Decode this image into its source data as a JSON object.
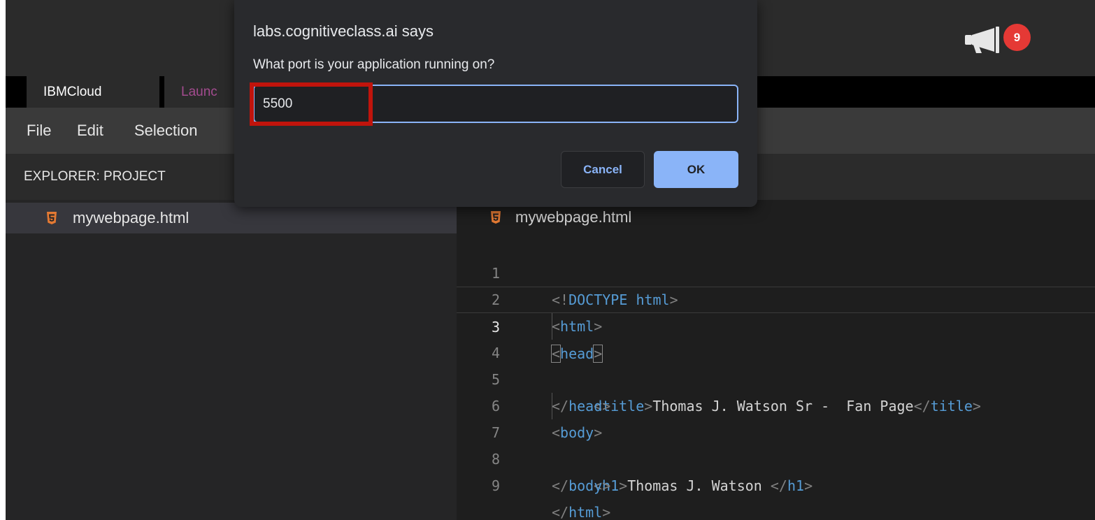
{
  "notifications": {
    "count": "9"
  },
  "tabs": [
    {
      "label": "IBMCloud"
    },
    {
      "label": "Launc"
    }
  ],
  "menu": [
    "File",
    "Edit",
    "Selection"
  ],
  "explorer": {
    "header": "EXPLORER: PROJECT",
    "files": [
      {
        "name": "mywebpage.html",
        "icon": "html5-icon"
      }
    ]
  },
  "editor": {
    "tab_title": "mywebpage.html",
    "current_line": 3,
    "lines": [
      {
        "n": "1"
      },
      {
        "n": "2"
      },
      {
        "n": "3"
      },
      {
        "n": "4",
        "text": "Thomas J. Watson Sr -  Fan Page"
      },
      {
        "n": "5"
      },
      {
        "n": "6"
      },
      {
        "n": "7",
        "text": "Thomas J. Watson "
      },
      {
        "n": "8"
      },
      {
        "n": "9"
      }
    ]
  },
  "dialog": {
    "title": "labs.cognitiveclass.ai says",
    "message": "What port is your application running on?",
    "input_value": "5500",
    "cancel_label": "Cancel",
    "ok_label": "OK",
    "focus_color": "#8ab4f8",
    "highlight_color": "#c0140c"
  }
}
